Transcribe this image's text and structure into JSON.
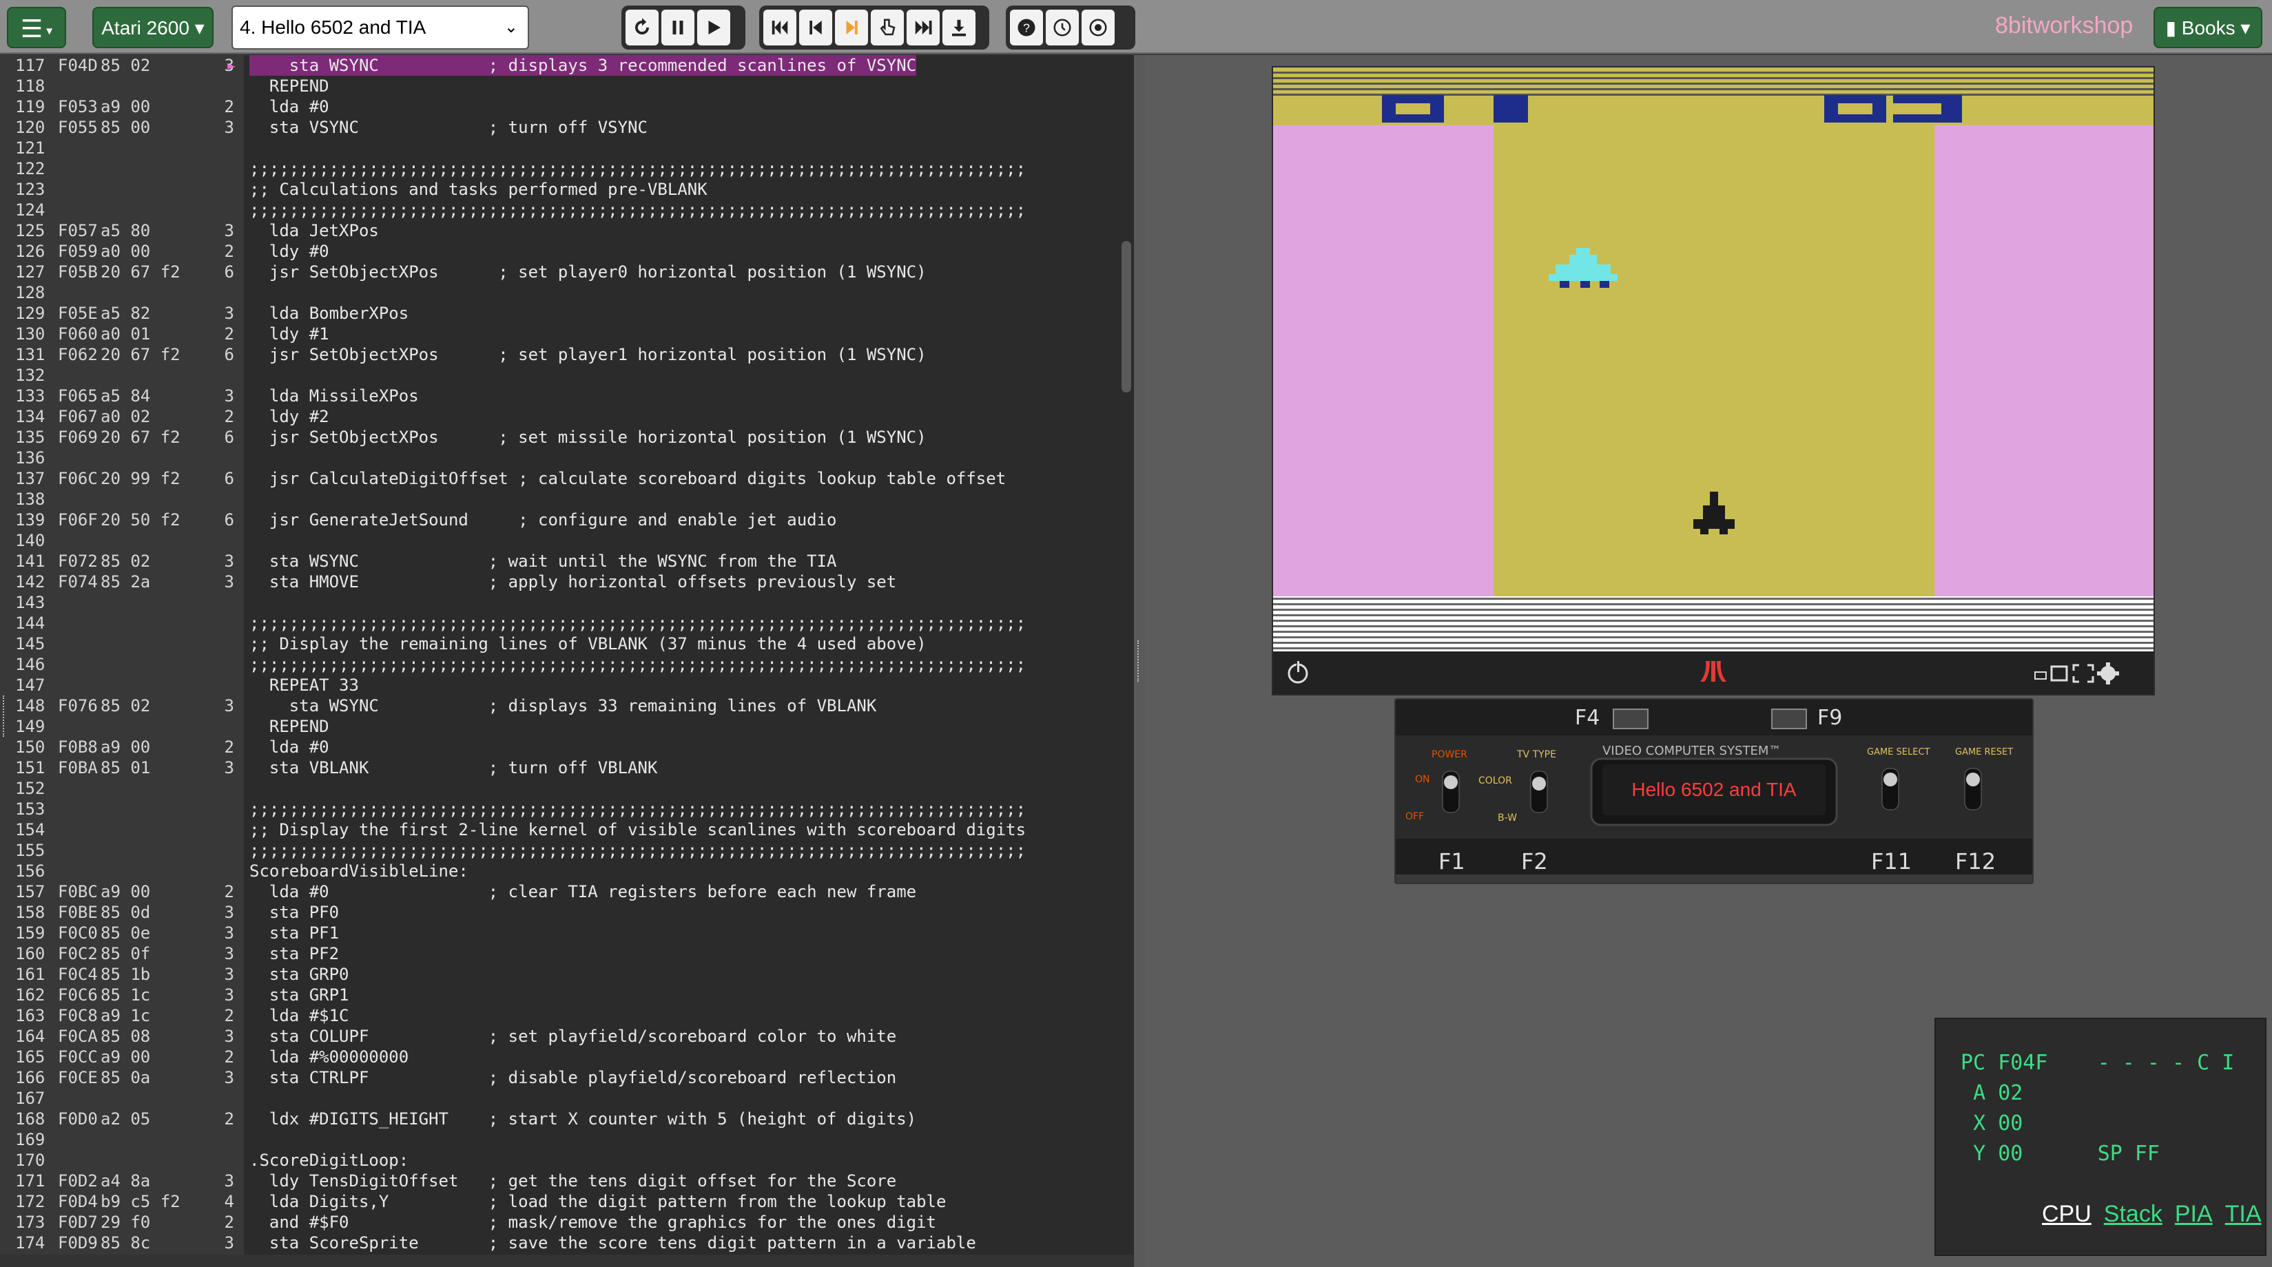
{
  "colors": {
    "accent": "#2e6b3c",
    "brand": "#f4a7c4",
    "highlight": "#7d2a78",
    "playfield_side": "#e0a5e0",
    "playfield_center": "#c8bd52",
    "score": "#1f2d8a",
    "register_text": "#3ddc84"
  },
  "toolbar": {
    "menu_icon": "hamburger-icon",
    "platform": "Atari 2600 ▾",
    "file_selected": "4. Hello 6502 and TIA",
    "brand": "8bitworkshop",
    "books": "Books ▾"
  },
  "editor": {
    "lines": [
      {
        "n": "117",
        "addr": "F04D",
        "bytes": "85 02",
        "cyc": "3",
        "src": "    sta WSYNC           ; displays 3 recommended scanlines of VSYNC",
        "hl": true,
        "ptr": "►"
      },
      {
        "n": "118",
        "addr": "",
        "bytes": "",
        "cyc": "",
        "src": "  REPEND"
      },
      {
        "n": "119",
        "addr": "F053",
        "bytes": "a9 00",
        "cyc": "2",
        "src": "  lda #0"
      },
      {
        "n": "120",
        "addr": "F055",
        "bytes": "85 00",
        "cyc": "3",
        "src": "  sta VSYNC             ; turn off VSYNC"
      },
      {
        "n": "121",
        "addr": "",
        "bytes": "",
        "cyc": "",
        "src": ""
      },
      {
        "n": "122",
        "addr": "",
        "bytes": "",
        "cyc": "",
        "src": ";;;;;;;;;;;;;;;;;;;;;;;;;;;;;;;;;;;;;;;;;;;;;;;;;;;;;;;;;;;;;;;;;;;;;;;;;;;;;;"
      },
      {
        "n": "123",
        "addr": "",
        "bytes": "",
        "cyc": "",
        "src": ";; Calculations and tasks performed pre-VBLANK"
      },
      {
        "n": "124",
        "addr": "",
        "bytes": "",
        "cyc": "",
        "src": ";;;;;;;;;;;;;;;;;;;;;;;;;;;;;;;;;;;;;;;;;;;;;;;;;;;;;;;;;;;;;;;;;;;;;;;;;;;;;;"
      },
      {
        "n": "125",
        "addr": "F057",
        "bytes": "a5 80",
        "cyc": "3",
        "src": "  lda JetXPos"
      },
      {
        "n": "126",
        "addr": "F059",
        "bytes": "a0 00",
        "cyc": "2",
        "src": "  ldy #0"
      },
      {
        "n": "127",
        "addr": "F05B",
        "bytes": "20 67 f2",
        "cyc": "6",
        "src": "  jsr SetObjectXPos      ; set player0 horizontal position (1 WSYNC)"
      },
      {
        "n": "128",
        "addr": "",
        "bytes": "",
        "cyc": "",
        "src": ""
      },
      {
        "n": "129",
        "addr": "F05E",
        "bytes": "a5 82",
        "cyc": "3",
        "src": "  lda BomberXPos"
      },
      {
        "n": "130",
        "addr": "F060",
        "bytes": "a0 01",
        "cyc": "2",
        "src": "  ldy #1"
      },
      {
        "n": "131",
        "addr": "F062",
        "bytes": "20 67 f2",
        "cyc": "6",
        "src": "  jsr SetObjectXPos      ; set player1 horizontal position (1 WSYNC)"
      },
      {
        "n": "132",
        "addr": "",
        "bytes": "",
        "cyc": "",
        "src": ""
      },
      {
        "n": "133",
        "addr": "F065",
        "bytes": "a5 84",
        "cyc": "3",
        "src": "  lda MissileXPos"
      },
      {
        "n": "134",
        "addr": "F067",
        "bytes": "a0 02",
        "cyc": "2",
        "src": "  ldy #2"
      },
      {
        "n": "135",
        "addr": "F069",
        "bytes": "20 67 f2",
        "cyc": "6",
        "src": "  jsr SetObjectXPos      ; set missile horizontal position (1 WSYNC)"
      },
      {
        "n": "136",
        "addr": "",
        "bytes": "",
        "cyc": "",
        "src": ""
      },
      {
        "n": "137",
        "addr": "F06C",
        "bytes": "20 99 f2",
        "cyc": "6",
        "src": "  jsr CalculateDigitOffset ; calculate scoreboard digits lookup table offset"
      },
      {
        "n": "138",
        "addr": "",
        "bytes": "",
        "cyc": "",
        "src": ""
      },
      {
        "n": "139",
        "addr": "F06F",
        "bytes": "20 50 f2",
        "cyc": "6",
        "src": "  jsr GenerateJetSound     ; configure and enable jet audio"
      },
      {
        "n": "140",
        "addr": "",
        "bytes": "",
        "cyc": "",
        "src": ""
      },
      {
        "n": "141",
        "addr": "F072",
        "bytes": "85 02",
        "cyc": "3",
        "src": "  sta WSYNC             ; wait until the WSYNC from the TIA"
      },
      {
        "n": "142",
        "addr": "F074",
        "bytes": "85 2a",
        "cyc": "3",
        "src": "  sta HMOVE             ; apply horizontal offsets previously set"
      },
      {
        "n": "143",
        "addr": "",
        "bytes": "",
        "cyc": "",
        "src": ""
      },
      {
        "n": "144",
        "addr": "",
        "bytes": "",
        "cyc": "",
        "src": ";;;;;;;;;;;;;;;;;;;;;;;;;;;;;;;;;;;;;;;;;;;;;;;;;;;;;;;;;;;;;;;;;;;;;;;;;;;;;;"
      },
      {
        "n": "145",
        "addr": "",
        "bytes": "",
        "cyc": "",
        "src": ";; Display the remaining lines of VBLANK (37 minus the 4 used above)"
      },
      {
        "n": "146",
        "addr": "",
        "bytes": "",
        "cyc": "",
        "src": ";;;;;;;;;;;;;;;;;;;;;;;;;;;;;;;;;;;;;;;;;;;;;;;;;;;;;;;;;;;;;;;;;;;;;;;;;;;;;;"
      },
      {
        "n": "147",
        "addr": "",
        "bytes": "",
        "cyc": "",
        "src": "  REPEAT 33"
      },
      {
        "n": "148",
        "addr": "F076",
        "bytes": "85 02",
        "cyc": "3",
        "src": "    sta WSYNC           ; displays 33 remaining lines of VBLANK"
      },
      {
        "n": "149",
        "addr": "",
        "bytes": "",
        "cyc": "",
        "src": "  REPEND"
      },
      {
        "n": "150",
        "addr": "F0B8",
        "bytes": "a9 00",
        "cyc": "2",
        "src": "  lda #0"
      },
      {
        "n": "151",
        "addr": "F0BA",
        "bytes": "85 01",
        "cyc": "3",
        "src": "  sta VBLANK            ; turn off VBLANK"
      },
      {
        "n": "152",
        "addr": "",
        "bytes": "",
        "cyc": "",
        "src": ""
      },
      {
        "n": "153",
        "addr": "",
        "bytes": "",
        "cyc": "",
        "src": ";;;;;;;;;;;;;;;;;;;;;;;;;;;;;;;;;;;;;;;;;;;;;;;;;;;;;;;;;;;;;;;;;;;;;;;;;;;;;;"
      },
      {
        "n": "154",
        "addr": "",
        "bytes": "",
        "cyc": "",
        "src": ";; Display the first 2-line kernel of visible scanlines with scoreboard digits"
      },
      {
        "n": "155",
        "addr": "",
        "bytes": "",
        "cyc": "",
        "src": ";;;;;;;;;;;;;;;;;;;;;;;;;;;;;;;;;;;;;;;;;;;;;;;;;;;;;;;;;;;;;;;;;;;;;;;;;;;;;;"
      },
      {
        "n": "156",
        "addr": "",
        "bytes": "",
        "cyc": "",
        "src": "ScoreboardVisibleLine:"
      },
      {
        "n": "157",
        "addr": "F0BC",
        "bytes": "a9 00",
        "cyc": "2",
        "src": "  lda #0                ; clear TIA registers before each new frame"
      },
      {
        "n": "158",
        "addr": "F0BE",
        "bytes": "85 0d",
        "cyc": "3",
        "src": "  sta PF0"
      },
      {
        "n": "159",
        "addr": "F0C0",
        "bytes": "85 0e",
        "cyc": "3",
        "src": "  sta PF1"
      },
      {
        "n": "160",
        "addr": "F0C2",
        "bytes": "85 0f",
        "cyc": "3",
        "src": "  sta PF2"
      },
      {
        "n": "161",
        "addr": "F0C4",
        "bytes": "85 1b",
        "cyc": "3",
        "src": "  sta GRP0"
      },
      {
        "n": "162",
        "addr": "F0C6",
        "bytes": "85 1c",
        "cyc": "3",
        "src": "  sta GRP1"
      },
      {
        "n": "163",
        "addr": "F0C8",
        "bytes": "a9 1c",
        "cyc": "2",
        "src": "  lda #$1C"
      },
      {
        "n": "164",
        "addr": "F0CA",
        "bytes": "85 08",
        "cyc": "3",
        "src": "  sta COLUPF            ; set playfield/scoreboard color to white"
      },
      {
        "n": "165",
        "addr": "F0CC",
        "bytes": "a9 00",
        "cyc": "2",
        "src": "  lda #%00000000"
      },
      {
        "n": "166",
        "addr": "F0CE",
        "bytes": "85 0a",
        "cyc": "3",
        "src": "  sta CTRLPF            ; disable playfield/scoreboard reflection"
      },
      {
        "n": "167",
        "addr": "",
        "bytes": "",
        "cyc": "",
        "src": ""
      },
      {
        "n": "168",
        "addr": "F0D0",
        "bytes": "a2 05",
        "cyc": "2",
        "src": "  ldx #DIGITS_HEIGHT    ; start X counter with 5 (height of digits)"
      },
      {
        "n": "169",
        "addr": "",
        "bytes": "",
        "cyc": "",
        "src": ""
      },
      {
        "n": "170",
        "addr": "",
        "bytes": "",
        "cyc": "",
        "src": ".ScoreDigitLoop:"
      },
      {
        "n": "171",
        "addr": "F0D2",
        "bytes": "a4 8a",
        "cyc": "3",
        "src": "  ldy TensDigitOffset   ; get the tens digit offset for the Score"
      },
      {
        "n": "172",
        "addr": "F0D4",
        "bytes": "b9 c5 f2",
        "cyc": "4",
        "src": "  lda Digits,Y          ; load the digit pattern from the lookup table"
      },
      {
        "n": "173",
        "addr": "F0D7",
        "bytes": "29 f0",
        "cyc": "2",
        "src": "  and #$F0              ; mask/remove the graphics for the ones digit"
      },
      {
        "n": "174",
        "addr": "F0D9",
        "bytes": "85 8c",
        "cyc": "3",
        "src": "  sta ScoreSprite       ; save the score tens digit pattern in a variable"
      }
    ]
  },
  "emulator": {
    "console_keys": {
      "f4": "F4",
      "f9": "F9",
      "f1": "F1",
      "f2": "F2",
      "f11": "F11",
      "f12": "F12"
    },
    "switch_labels": {
      "power": "POWER",
      "on": "ON",
      "off": "OFF",
      "tv_type": "TV TYPE",
      "color": "COLOR",
      "bw": "B-W",
      "game_select": "GAME SELECT",
      "game_reset": "GAME RESET"
    },
    "console_brand": "VIDEO COMPUTER SYSTEM™",
    "cartridge_label": "Hello 6502 and TIA",
    "controls": [
      "power-icon",
      "atari-logo-icon",
      "minimize-icon",
      "window-icon",
      "fullscreen-icon",
      "gear-icon"
    ]
  },
  "debug": {
    "pc_label": "PC",
    "pc": "F04F",
    "flags": "- - - - C I",
    "a_label": "A",
    "a": "02",
    "x_label": "X",
    "x": "00",
    "y_label": "Y",
    "y": "00",
    "sp_label": "SP",
    "sp": "FF",
    "tabs": [
      "CPU",
      "Stack",
      "PIA",
      "TIA"
    ]
  }
}
